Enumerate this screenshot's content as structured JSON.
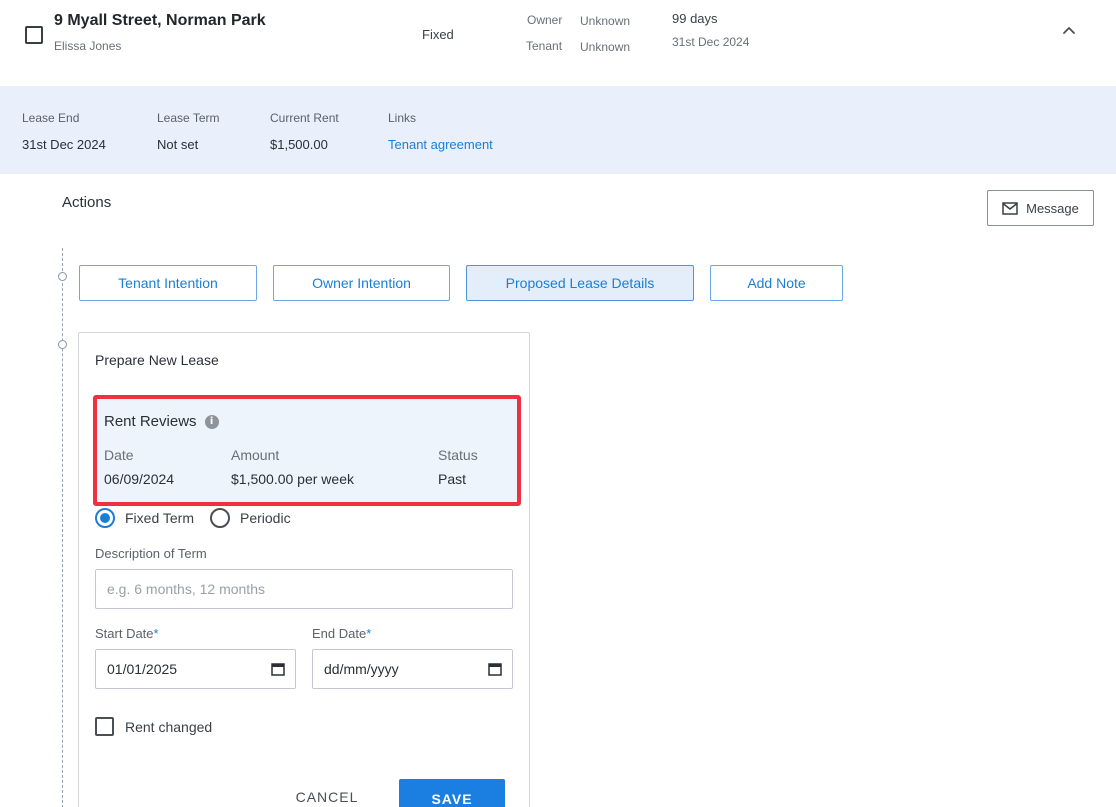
{
  "property": {
    "address": "9 Myall Street, Norman Park",
    "contact": "Elissa Jones",
    "lease_type": "Fixed",
    "owner_label": "Owner",
    "owner_value": "Unknown",
    "tenant_label": "Tenant",
    "tenant_value": "Unknown",
    "days_remaining": "99 days",
    "end_date": "31st Dec 2024"
  },
  "summary": {
    "lease_end_label": "Lease End",
    "lease_end_value": "31st Dec 2024",
    "lease_term_label": "Lease Term",
    "lease_term_value": "Not set",
    "current_rent_label": "Current Rent",
    "current_rent_value": "$1,500.00",
    "links_label": "Links",
    "link_text": "Tenant agreement"
  },
  "actions": {
    "title": "Actions",
    "message_label": "Message",
    "buttons": [
      {
        "label": "Tenant Intention"
      },
      {
        "label": "Owner Intention"
      },
      {
        "label": "Proposed Lease Details"
      },
      {
        "label": "Add Note"
      }
    ]
  },
  "form": {
    "title": "Prepare New Lease",
    "rent_reviews": {
      "title": "Rent Reviews",
      "columns": [
        "Date",
        "Amount",
        "Status"
      ],
      "rows": [
        {
          "date": "06/09/2024",
          "amount": "$1,500.00 per week",
          "status": "Past"
        }
      ]
    },
    "term_options": [
      "Fixed Term",
      "Periodic"
    ],
    "selected_term": "Fixed Term",
    "description_label": "Description of Term",
    "description_placeholder": "e.g. 6 months, 12 months",
    "start_date_label": "Start Date",
    "start_date_value": "01/01/2025",
    "end_date_label": "End Date",
    "end_date_placeholder": "dd/mm/yyyy",
    "required_mark": "*",
    "rent_changed_label": "Rent changed",
    "cancel_label": "CANCEL",
    "save_label": "SAVE"
  },
  "colors": {
    "accent": "#1a7fe0",
    "highlight_border": "#ee3140",
    "info_strip_bg": "#e9f0fb"
  },
  "icons": {
    "checkbox": "checkbox-icon",
    "collapse": "chevron-up-icon",
    "message": "envelope-icon",
    "info": "info-icon",
    "calendar": "calendar-icon"
  }
}
